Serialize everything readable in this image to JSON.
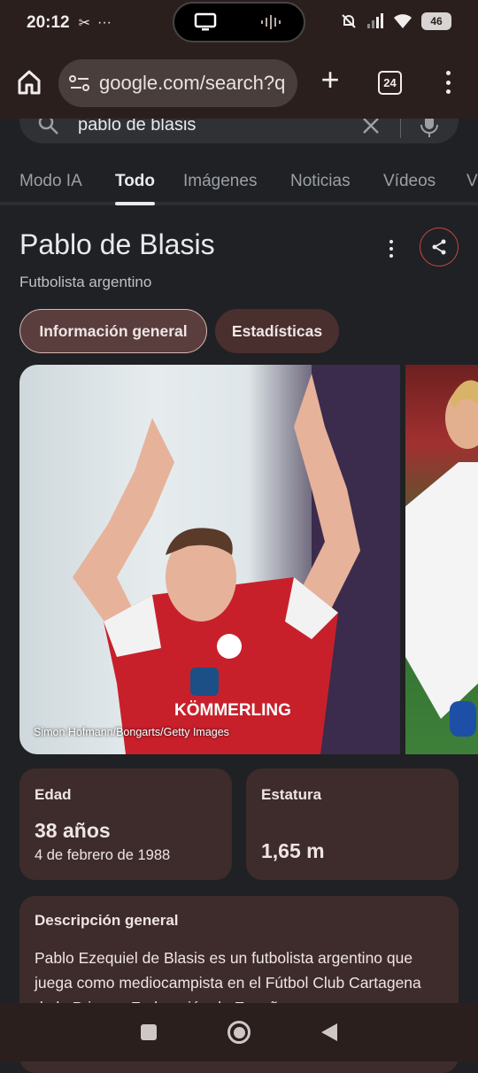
{
  "status": {
    "time": "20:12",
    "left_icons": [
      "scissors-icon",
      "more-dots-icon"
    ],
    "battery": "46"
  },
  "browser": {
    "url": "google.com/search?q",
    "tab_count": "24"
  },
  "search": {
    "query": "pablo de blasis"
  },
  "tabs": [
    {
      "label": "Modo IA"
    },
    {
      "label": "Todo"
    },
    {
      "label": "Imágenes"
    },
    {
      "label": "Noticias"
    },
    {
      "label": "Vídeos"
    },
    {
      "label": "V"
    }
  ],
  "panel": {
    "title": "Pablo de Blasis",
    "subtitle": "Futbolista argentino",
    "chips": [
      "Información general",
      "Estadísticas"
    ],
    "photo_credit": "Simon Hofmann/Bongarts/Getty Images",
    "jersey_text": "KÖMMERLING"
  },
  "facts": {
    "age_label": "Edad",
    "age_value": "38 años",
    "birth_date": "4 de febrero de 1988",
    "height_label": "Estatura",
    "height_value": "1,65 m"
  },
  "description": {
    "title": "Descripción general",
    "text": "Pablo Ezequiel de Blasis es un futbolista argentino que juega como mediocampista en el Fútbol Club Cartagena de la Primera Federación de España."
  }
}
